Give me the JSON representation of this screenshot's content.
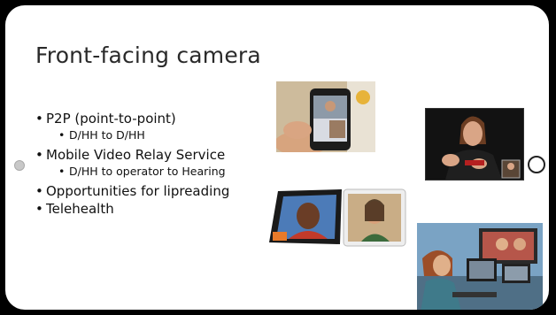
{
  "slide": {
    "title": "Front-facing camera",
    "bullets": [
      {
        "text": "P2P (point-to-point)",
        "sub": [
          "D/HH to D/HH"
        ]
      },
      {
        "text": "Mobile Video Relay Service",
        "sub": [
          "D/HH to operator to Hearing"
        ]
      },
      {
        "text": "Opportunities for lipreading",
        "sub": []
      },
      {
        "text": "Telehealth",
        "sub": []
      }
    ]
  },
  "colors": {
    "background": "#000000",
    "slide": "#ffffff",
    "text": "#111111"
  }
}
